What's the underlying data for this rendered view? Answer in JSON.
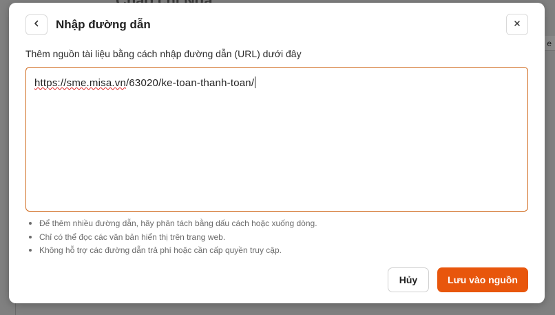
{
  "background": {
    "heading": "Chào chị Nga",
    "side_fragment": "c e"
  },
  "dialog": {
    "title": "Nhập đường dẫn",
    "instruction": "Thêm nguồn tài liệu bằng cách nhập đường dẫn (URL) dưới đây",
    "url_input": {
      "value_spellchecked": "https://sme.misa.vn",
      "value_rest": "/63020/ke-toan-thanh-toan/",
      "value": "https://sme.misa.vn/63020/ke-toan-thanh-toan/"
    },
    "notes": [
      "Để thêm nhiều đường dẫn, hãy phân tách bằng dấu cách hoặc xuống dòng.",
      "Chỉ có thể đọc các văn bản hiển thị trên trang web.",
      "Không hỗ trợ các đường dẫn trả phí hoặc cần cấp quyền truy cập."
    ],
    "cancel_label": "Hủy",
    "save_label": "Lưu vào nguồn"
  },
  "colors": {
    "accent": "#e8560c",
    "input_border": "#d06a1e",
    "overlay": "#808080"
  },
  "icons": {
    "back": "chevron-left-icon",
    "close": "close-icon"
  }
}
